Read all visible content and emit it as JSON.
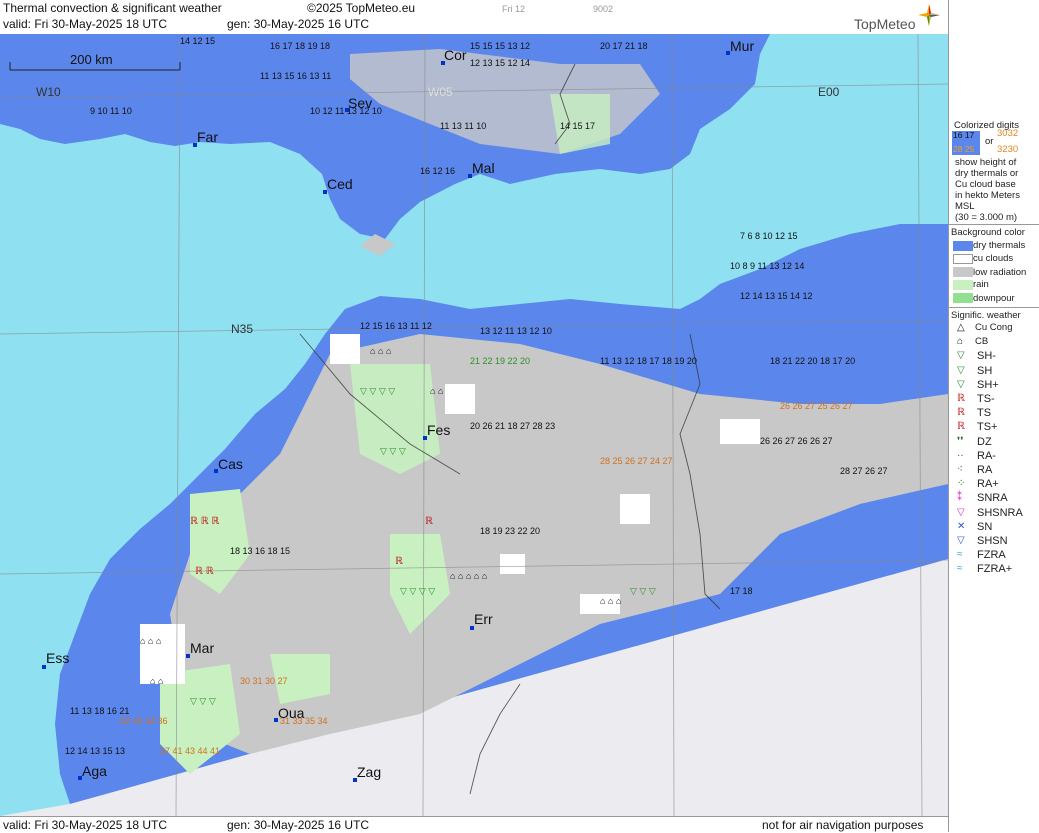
{
  "header": {
    "title": "Thermal convection & significant weather",
    "copyright": "©2025 TopMeteo.eu",
    "tab_day": "Fri 12",
    "code": "9002",
    "valid": "valid:  Fri  30-May-2025  18 UTC",
    "generated": "gen: 30-May-2025 16 UTC",
    "brand": "TopMeteo"
  },
  "footer": {
    "valid": "valid:  Fri  30-May-2025  18 UTC",
    "generated": "gen: 30-May-2025 16 UTC",
    "note": "not for air navigation purposes"
  },
  "map": {
    "scale_label": "200 km",
    "grid_labels": {
      "w10": "W10",
      "w05": "W05",
      "e00": "E00",
      "n35": "N35"
    },
    "cities": [
      {
        "name": "Cor"
      },
      {
        "name": "Mur"
      },
      {
        "name": "Sev"
      },
      {
        "name": "Far"
      },
      {
        "name": "Mal"
      },
      {
        "name": "Ced"
      },
      {
        "name": "Fes"
      },
      {
        "name": "Cas"
      },
      {
        "name": "Err"
      },
      {
        "name": "Ess"
      },
      {
        "name": "Mar"
      },
      {
        "name": "Oua"
      },
      {
        "name": "Aga"
      },
      {
        "name": "Zag"
      }
    ],
    "colors": {
      "sea": "#8fe0f0",
      "dry_thermals": "#5b86ec",
      "cu_clouds": "#ffffff",
      "low_radiation": "#c8c8c8",
      "rain": "#c8f0c0",
      "downpour": "#90e090",
      "outside_domain": "#ececf0"
    }
  },
  "legend": {
    "colorized_title": "Colorized digits",
    "sample_a": "16 17",
    "sample_b": "28 25",
    "or": "or",
    "sample_c": "3032",
    "sample_d": "3230",
    "desc1": "show height of",
    "desc2": "dry thermals or",
    "desc3": "Cu cloud base",
    "desc4": "in hekto Meters",
    "desc5": "MSL",
    "desc6": "(30 = 3.000 m)",
    "bg_title": "Background color",
    "bg_items": [
      "dry thermals",
      "cu clouds",
      "low radiation",
      "rain",
      "downpour"
    ],
    "wx_title": "Signific. weather",
    "wx_items": [
      "Cu Cong",
      "CB",
      "SH-",
      "SH",
      "SH+",
      "TS-",
      "TS",
      "TS+",
      "DZ",
      "RA-",
      "RA",
      "RA+",
      "SNRA",
      "SHSNRA",
      "SN",
      "SHSN",
      "FZRA",
      "FZRA+"
    ],
    "wx_icons": [
      "cu-cong-icon",
      "cb-icon",
      "shower-light-icon",
      "shower-icon",
      "shower-heavy-icon",
      "thunderstorm-light-icon",
      "thunderstorm-icon",
      "thunderstorm-heavy-icon",
      "drizzle-icon",
      "rain-light-icon",
      "rain-icon",
      "rain-heavy-icon",
      "snow-rain-icon",
      "snow-rain-shower-icon",
      "snow-icon",
      "snow-shower-icon",
      "freezing-rain-icon",
      "freezing-rain-heavy-icon"
    ]
  }
}
